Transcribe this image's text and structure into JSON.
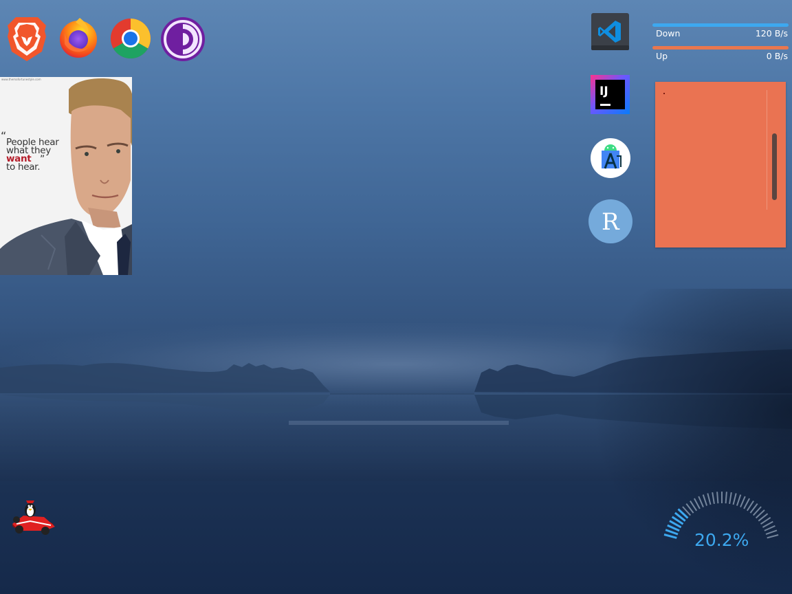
{
  "desktop": {
    "launchers": [
      {
        "name": "Brave",
        "icon": "brave-lion-icon"
      },
      {
        "name": "Firefox",
        "icon": "firefox-icon"
      },
      {
        "name": "Chrome",
        "icon": "chrome-icon"
      },
      {
        "name": "Tor Browser",
        "icon": "tor-browser-icon"
      },
      {
        "name": "Visual Studio Code",
        "icon": "vscode-icon"
      },
      {
        "name": "IntelliJ IDEA",
        "icon": "intellij-icon",
        "text": "IJ"
      },
      {
        "name": "Android Studio",
        "icon": "android-studio-icon"
      },
      {
        "name": "RStudio",
        "icon": "rstudio-icon",
        "text": "R"
      },
      {
        "name": "SuperTuxKart",
        "icon": "supertuxkart-icon"
      }
    ]
  },
  "photo_widget": {
    "site": "www.themafortunestyle.com",
    "quote_open": "“",
    "quote_line1": "People hear",
    "quote_line2": "what they",
    "quote_emphasis": "want",
    "quote_close": "”",
    "quote_line4": "to hear."
  },
  "network": {
    "down": {
      "label": "Down",
      "value": "120 B/s",
      "color": "#3da8ef"
    },
    "up": {
      "label": "Up",
      "value": "0 B/s",
      "color": "#e9774e"
    }
  },
  "sticky_note": {
    "color": "#ea7352"
  },
  "cpu": {
    "value": "20.2%",
    "fraction": 0.202,
    "accent": "#3da8ef"
  }
}
